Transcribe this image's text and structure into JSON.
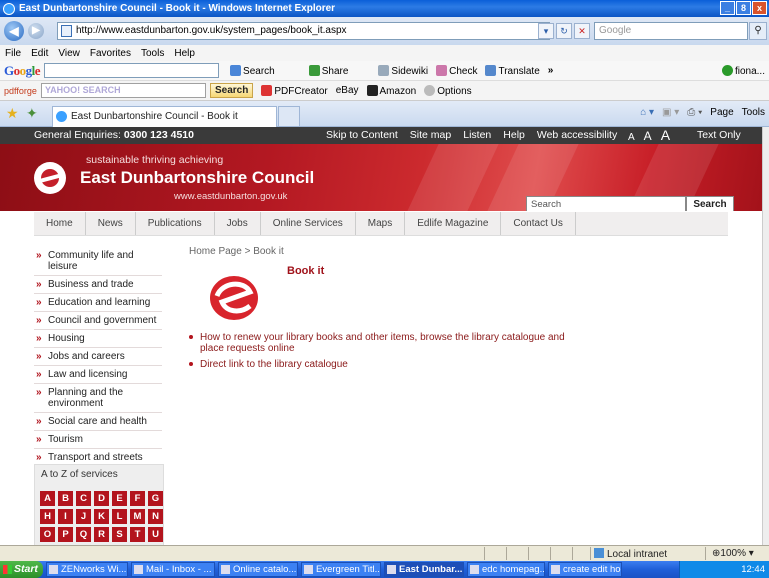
{
  "window": {
    "title": "East Dunbartonshire Council - Book it - Windows Internet Explorer",
    "min": "_",
    "max": "8",
    "close": "x"
  },
  "browser": {
    "url": "http://www.eastdunbarton.gov.uk/system_pages/book_it.aspx",
    "search_placeholder": "Google",
    "menu": [
      "File",
      "Edit",
      "View",
      "Favorites",
      "Tools",
      "Help"
    ],
    "google_toolbar": [
      "Search",
      "Share",
      "Sidewiki",
      "Check",
      "Translate",
      "»",
      "fiona..."
    ],
    "pdfforge_label": "pdfforge",
    "yahoo_box_text": "YAHOO! SEARCH",
    "yahoo_search_btn": "Search",
    "yahoo_toolbar": [
      "PDFCreator",
      "eBay",
      "Amazon",
      "Options"
    ],
    "tab_title": "East Dunbartonshire Council - Book it",
    "command_bar": [
      "Page",
      "Tools"
    ]
  },
  "site": {
    "enquiries_label": "General Enquiries:",
    "enquiries_number": "0300 123 4510",
    "top_links": [
      "Skip to Content",
      "Site map",
      "Listen",
      "Help",
      "Web accessibility"
    ],
    "text_sizes": [
      "A",
      "A",
      "A"
    ],
    "text_only": "Text Only",
    "tagline": "sustainable thriving achieving",
    "council_name": "East Dunbartonshire Council",
    "council_url": "www.eastdunbarton.gov.uk",
    "search_placeholder": "Search",
    "search_button": "Search",
    "nav": [
      "Home",
      "News",
      "Publications",
      "Jobs",
      "Online Services",
      "Maps",
      "Edlife Magazine",
      "Contact Us"
    ],
    "sidebar": [
      "Community life and leisure",
      "Business and trade",
      "Education and learning",
      "Council and government",
      "Housing",
      "Jobs and careers",
      "Law and licensing",
      "Planning and the environment",
      "Social care and health",
      "Tourism",
      "Transport and streets"
    ],
    "az_title": "A to Z of services",
    "az_letters": [
      "A",
      "B",
      "C",
      "D",
      "E",
      "F",
      "G",
      "H",
      "I",
      "J",
      "K",
      "L",
      "M",
      "N",
      "O",
      "P",
      "Q",
      "R",
      "S",
      "T",
      "U"
    ],
    "breadcrumb": "Home Page  >  Book it",
    "page_title": "Book it",
    "links": [
      "How to renew your library books and other items, browse the library catalogue and place requests online",
      "Direct link to the library catalogue"
    ]
  },
  "status": {
    "zone": "Local intranet",
    "zoom": "100%"
  },
  "taskbar": {
    "start": "Start",
    "tasks": [
      "ZENworks Wi...",
      "Mail - Inbox - ...",
      "Online catalo...",
      "Evergreen Titl...",
      "East Dunbar...",
      "edc homepag...",
      "create edit ho..."
    ],
    "clock": "12:44"
  },
  "colors": {
    "brand_red": "#b3141d",
    "top_strip": "#3a3a3a"
  }
}
